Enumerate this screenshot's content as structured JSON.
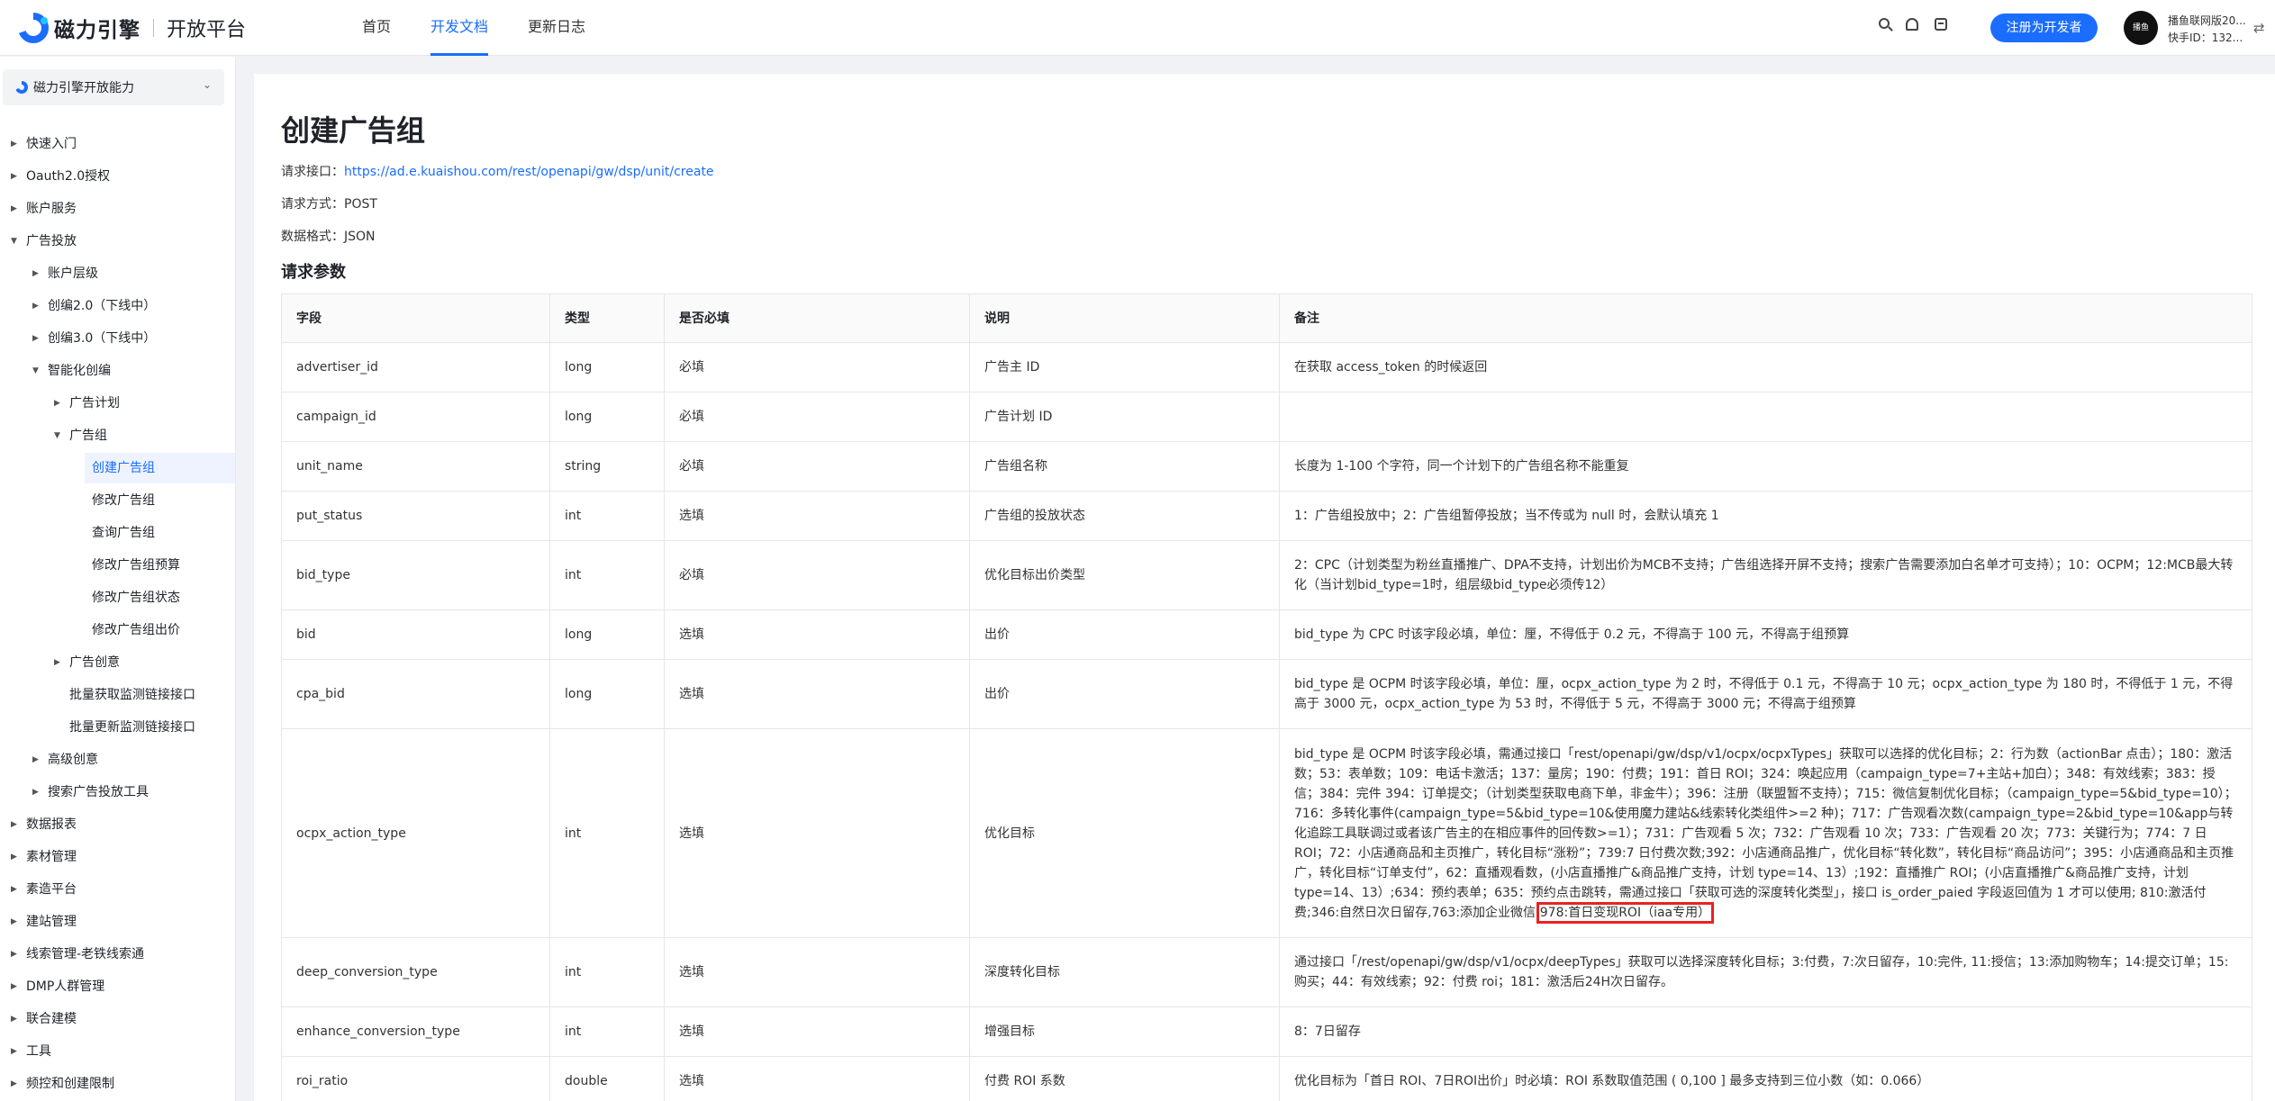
{
  "header": {
    "brand": "磁力引擎",
    "platform": "开放平台",
    "nav": [
      "首页",
      "开发文档",
      "更新日志"
    ],
    "register": "注册为开发者",
    "avatar_text": "播鱼",
    "user_name": "播鱼联网版20...",
    "user_id": "快手ID：132...",
    "switch_icon": "⇄"
  },
  "sidebar": {
    "select": "磁力引擎开放能力",
    "items": [
      {
        "label": "快速入门",
        "level": 0,
        "caret": "▶"
      },
      {
        "label": "Oauth2.0授权",
        "level": 0,
        "caret": "▶"
      },
      {
        "label": "账户服务",
        "level": 0,
        "caret": "▶"
      },
      {
        "label": "广告投放",
        "level": 0,
        "caret": "▼"
      },
      {
        "label": "账户层级",
        "level": 1,
        "caret": "▶"
      },
      {
        "label": "创编2.0（下线中）",
        "level": 1,
        "caret": "▶"
      },
      {
        "label": "创编3.0（下线中）",
        "level": 1,
        "caret": "▶"
      },
      {
        "label": "智能化创编",
        "level": 1,
        "caret": "▼"
      },
      {
        "label": "广告计划",
        "level": 2,
        "caret": "▶"
      },
      {
        "label": "广告组",
        "level": 2,
        "caret": "▼"
      },
      {
        "label": "创建广告组",
        "level": 3,
        "caret": ""
      },
      {
        "label": "修改广告组",
        "level": 3,
        "caret": ""
      },
      {
        "label": "查询广告组",
        "level": 3,
        "caret": ""
      },
      {
        "label": "修改广告组预算",
        "level": 3,
        "caret": ""
      },
      {
        "label": "修改广告组状态",
        "level": 3,
        "caret": ""
      },
      {
        "label": "修改广告组出价",
        "level": 3,
        "caret": ""
      },
      {
        "label": "广告创意",
        "level": 2,
        "caret": "▶"
      },
      {
        "label": "批量获取监测链接接口",
        "level": 2,
        "caret": ""
      },
      {
        "label": "批量更新监测链接接口",
        "level": 2,
        "caret": ""
      },
      {
        "label": "高级创意",
        "level": 1,
        "caret": "▶"
      },
      {
        "label": "搜索广告投放工具",
        "level": 1,
        "caret": "▶"
      },
      {
        "label": "数据报表",
        "level": 0,
        "caret": "▶"
      },
      {
        "label": "素材管理",
        "level": 0,
        "caret": "▶"
      },
      {
        "label": "素造平台",
        "level": 0,
        "caret": "▶"
      },
      {
        "label": "建站管理",
        "level": 0,
        "caret": "▶"
      },
      {
        "label": "线索管理-老铁线索通",
        "level": 0,
        "caret": "▶"
      },
      {
        "label": "DMP人群管理",
        "level": 0,
        "caret": "▶"
      },
      {
        "label": "联合建模",
        "level": 0,
        "caret": "▶"
      },
      {
        "label": "工具",
        "level": 0,
        "caret": "▶"
      },
      {
        "label": "频控和创建限制",
        "level": 0,
        "caret": "▶"
      }
    ]
  },
  "main": {
    "title": "创建广告组",
    "endpoint_label": "请求接口：",
    "endpoint_url": "https://ad.e.kuaishou.com/rest/openapi/gw/dsp/unit/create",
    "method_label": "请求方式：",
    "method": "POST",
    "format_label": "数据格式：",
    "format": "JSON",
    "params_title": "请求参数",
    "table": {
      "headers": [
        "字段",
        "类型",
        "是否必填",
        "说明",
        "备注"
      ],
      "rows": [
        [
          "advertiser_id",
          "long",
          "必填",
          "广告主 ID",
          "在获取 access_token 的时候返回"
        ],
        [
          "campaign_id",
          "long",
          "必填",
          "广告计划 ID",
          ""
        ],
        [
          "unit_name",
          "string",
          "必填",
          "广告组名称",
          "长度为 1-100 个字符，同一个计划下的广告组名称不能重复"
        ],
        [
          "put_status",
          "int",
          "选填",
          "广告组的投放状态",
          "1：广告组投放中；2：广告组暂停投放；当不传或为 null 时，会默认填充 1"
        ],
        [
          "bid_type",
          "int",
          "必填",
          "优化目标出价类型",
          "2：CPC（计划类型为粉丝直播推广、DPA不支持，计划出价为MCB不支持；广告组选择开屏不支持；搜索广告需要添加白名单才可支持）；10：OCPM；12:MCB最大转化（当计划bid_type=1时，组层级bid_type必须传12）"
        ],
        [
          "bid",
          "long",
          "选填",
          "出价",
          "bid_type 为 CPC 时该字段必填，单位：厘，不得低于 0.2 元，不得高于 100 元，不得高于组预算"
        ],
        [
          "cpa_bid",
          "long",
          "选填",
          "出价",
          "bid_type 是 OCPM 时该字段必填，单位：厘，ocpx_action_type 为 2 时，不得低于 0.1 元，不得高于 10 元；ocpx_action_type 为 180 时，不得低于 1 元，不得高于 3000 元，ocpx_action_type 为 53 时，不得低于 5 元，不得高于 3000 元；不得高于组预算"
        ],
        [
          "ocpx_action_type",
          "int",
          "选填",
          "优化目标",
          "bid_type 是 OCPM 时该字段必填，需通过接口「rest/openapi/gw/dsp/v1/ocpx/ocpxTypes」获取可以选择的优化目标；2：行为数（actionBar 点击）；180：激活数；53：表单数；109：电话卡激活；137：量房；190：付费；191：首日 ROI；324：唤起应用（campaign_type=7+主站+加白）；348：有效线索；383：授信；384：完件 394：订单提交；（计划类型获取电商下单，非金牛）；396：注册（联盟暂不支持）；715：微信复制优化目标；（campaign_type=5&bid_type=10）；716：多转化事件(campaign_type=5&bid_type=10&使用魔力建站&线索转化类组件>=2 种)；717：广告观看次数(campaign_type=2&bid_type=10&app与转化追踪工具联调过或者该广告主的在相应事件的回传数>=1）；731：广告观看 5 次；732：广告观看 10 次；733：广告观看 20 次；773：关键行为；774：7 日 ROI；72：小店通商品和主页推广，转化目标“涨粉”；739:7 日付费次数;392：小店通商品推广，优化目标“转化数”，转化目标“商品访问”；395：小店通商品和主页推广，转化目标“订单支付”，62：直播观看数，(小店直播推广&商品推广支持，计划 type=14、13）;192：直播推广 ROI；(小店直播推广&商品推广支持，计划 type=14、13）;634：预约表单；635：预约点击跳转，需通过接口「获取可选的深度转化类型」，接口 is_order_paied 字段返回值为 1 才可以使用; 810:激活付费;346:自然日次日留存,763:添加企业微信;",
          "978:首日变现ROI（iaa专用）"
        ],
        [
          "deep_conversion_type",
          "int",
          "选填",
          "深度转化目标",
          "通过接口「/rest/openapi/gw/dsp/v1/ocpx/deepTypes」获取可以选择深度转化目标；3:付费，7:次日留存，10:完件, 11:授信；13:添加购物车；14:提交订单；15:购买；44：有效线索；92：付费 roi；181：激活后24H次日留存。"
        ],
        [
          "enhance_conversion_type",
          "int",
          "选填",
          "增强目标",
          "8：7日留存"
        ],
        [
          "roi_ratio",
          "double",
          "选填",
          "付费 ROI 系数",
          "优化目标为「首日 ROI、7日ROI出价」时必填：ROI 系数取值范围 ( 0,100 ] 最多支持到三位小数（如：0.066）"
        ]
      ]
    }
  }
}
